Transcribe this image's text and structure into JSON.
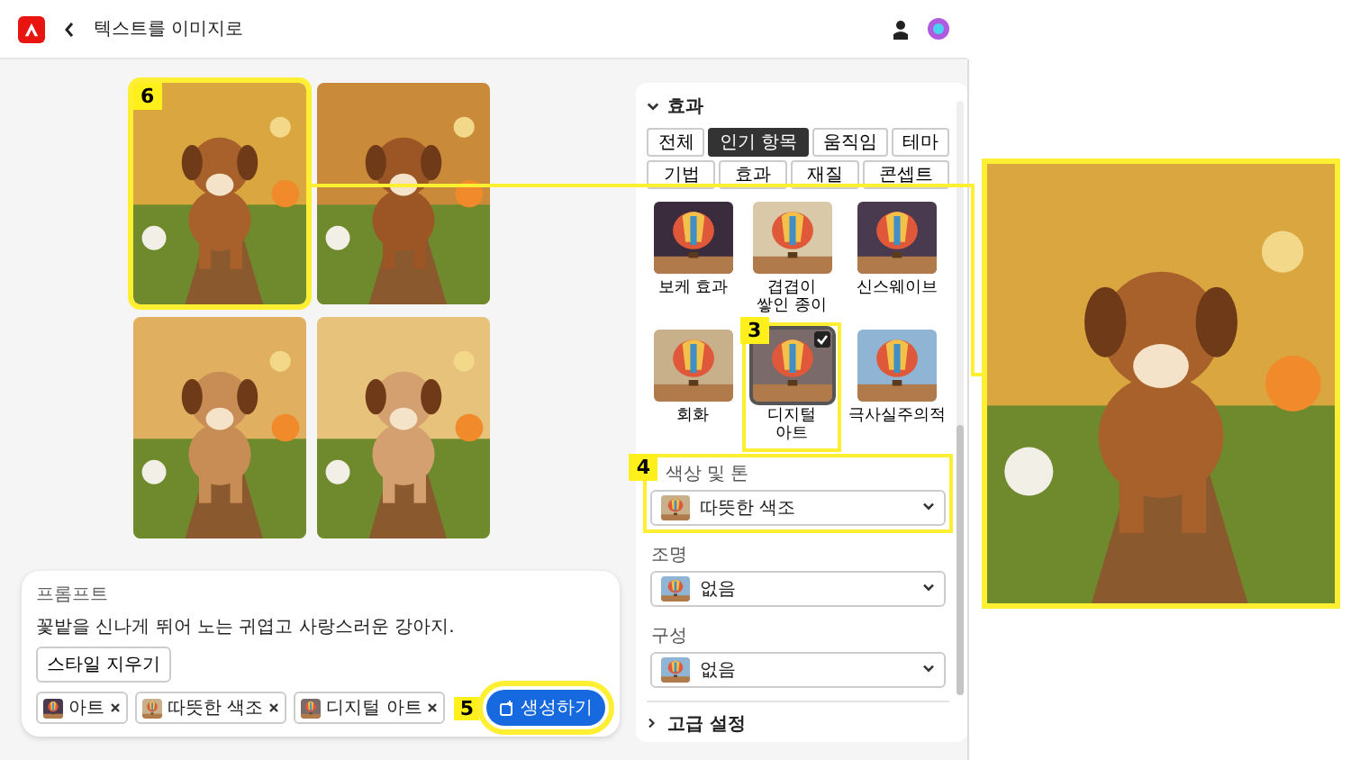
{
  "header": {
    "title": "텍스트를 이미지로"
  },
  "gallery": {
    "images": [
      {
        "kind": "picture",
        "callout": "6"
      },
      {
        "kind": "picture"
      },
      {
        "kind": "picture"
      },
      {
        "kind": "picture"
      }
    ]
  },
  "prompt": {
    "label": "프롬프트",
    "text": "꽃밭을 신나게 뛰어 노는 귀엽고 사랑스러운 강아지.",
    "clear_button": "스타일 지우기",
    "chips": [
      {
        "label": "아트"
      },
      {
        "label": "따뜻한 색조"
      },
      {
        "label": "디지털 아트"
      }
    ],
    "generate_button": "생성하기",
    "callout": "5"
  },
  "panel": {
    "section": "효과",
    "expanded": true,
    "categories": [
      {
        "label": "전체",
        "selected": false
      },
      {
        "label": "인기 항목",
        "selected": true
      },
      {
        "label": "움직임",
        "selected": false
      },
      {
        "label": "테마",
        "selected": false
      },
      {
        "label": "기법",
        "selected": false
      },
      {
        "label": "효과",
        "selected": false
      },
      {
        "label": "재질",
        "selected": false
      },
      {
        "label": "콘셉트",
        "selected": false
      }
    ],
    "styles": [
      {
        "label": "보케 효과",
        "selected": false
      },
      {
        "label": "겹겹이 쌓인 종이",
        "selected": false
      },
      {
        "label": "신스웨이브",
        "selected": false
      },
      {
        "label": "회화",
        "selected": false
      },
      {
        "label": "디지털 아트",
        "selected": true,
        "callout": "3"
      },
      {
        "label": "극사실주의적",
        "selected": false
      }
    ],
    "dropdowns": [
      {
        "label": "색상 및 톤",
        "value": "따뜻한 색조",
        "callout": "4"
      },
      {
        "label": "조명",
        "value": "없음"
      },
      {
        "label": "구성",
        "value": "없음"
      }
    ],
    "advanced": {
      "label": "고급 설정",
      "expanded": false
    }
  },
  "preview": {
    "kind": "picture"
  }
}
